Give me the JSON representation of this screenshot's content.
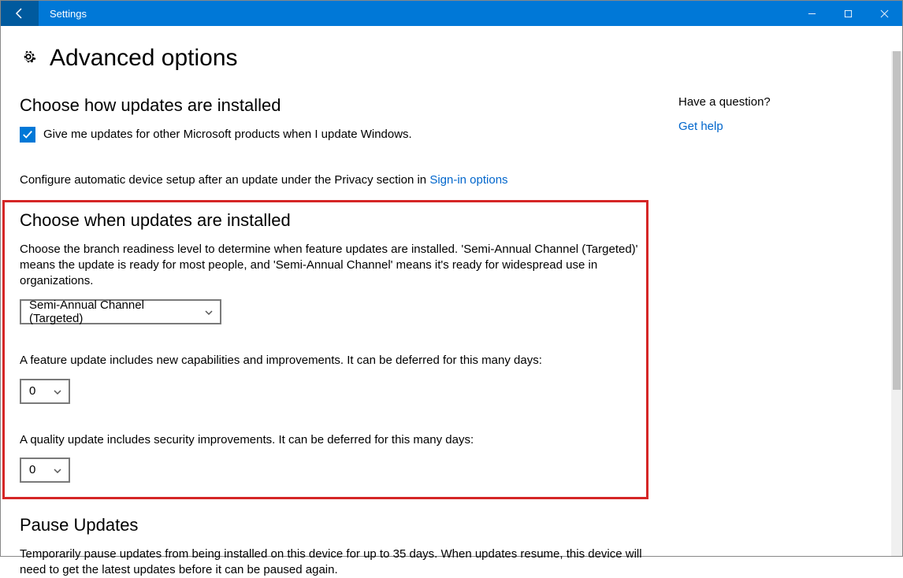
{
  "titlebar": {
    "app_name": "Settings"
  },
  "header": {
    "title": "Advanced options"
  },
  "section1": {
    "heading": "Choose how updates are installed",
    "checkbox_label": "Give me updates for other Microsoft products when I update Windows.",
    "configure_prefix": "Configure automatic device setup after an update under the Privacy section in ",
    "signin_link": "Sign-in options"
  },
  "section2": {
    "heading": "Choose when updates are installed",
    "branch_desc": "Choose the branch readiness level to determine when feature updates are installed. 'Semi-Annual Channel (Targeted)' means the update is ready for most people, and 'Semi-Annual Channel' means it's ready for widespread use in organizations.",
    "branch_selected": "Semi-Annual Channel (Targeted)",
    "feature_desc": "A feature update includes new capabilities and improvements. It can be deferred for this many days:",
    "feature_days": "0",
    "quality_desc": "A quality update includes security improvements. It can be deferred for this many days:",
    "quality_days": "0"
  },
  "section3": {
    "heading": "Pause Updates",
    "desc": "Temporarily pause updates from being installed on this device for up to 35 days. When updates resume, this device will need to get the latest updates before it can be paused again."
  },
  "sidebar": {
    "question": "Have a question?",
    "help_link": "Get help"
  }
}
